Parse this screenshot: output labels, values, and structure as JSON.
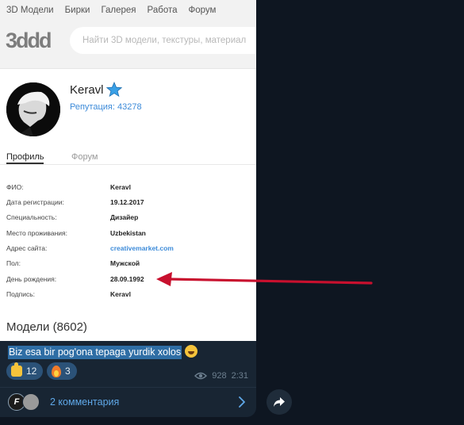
{
  "site": {
    "nav_items": [
      "3D Модели",
      "Бирки",
      "Галерея",
      "Работа",
      "Форум"
    ],
    "logo_text": "3ddd",
    "search_placeholder": "Найти 3D модели, текстуры, материал"
  },
  "profile": {
    "username": "Keravl",
    "reputation": "Репутация: 43278",
    "tabs": [
      "Профиль",
      "Форум"
    ],
    "fields": [
      {
        "label": "ФИО:",
        "value": "Keravl",
        "link": false
      },
      {
        "label": "Дата регистрации:",
        "value": "19.12.2017",
        "link": false
      },
      {
        "label": "Специальность:",
        "value": "Дизайер",
        "link": false
      },
      {
        "label": "Место проживания:",
        "value": "Uzbekistan",
        "link": false
      },
      {
        "label": "Адрес сайта:",
        "value": "creativemarket.com",
        "link": true
      },
      {
        "label": "Пол:",
        "value": "Мужской",
        "link": false
      },
      {
        "label": "День рождения:",
        "value": "28.09.1992",
        "link": false
      },
      {
        "label": "Подпись:",
        "value": "Keravl",
        "link": false
      }
    ],
    "models_heading": "Модели (8602)"
  },
  "message": {
    "caption": "Biz esa bir pog'ona tepaga yurdik xolos",
    "reactions": [
      {
        "icon": "thumbs-up-icon",
        "count": "12"
      },
      {
        "icon": "fire-icon",
        "count": "3"
      }
    ],
    "views": "928",
    "time": "2:31",
    "comments_label": "2 комментария"
  },
  "colors": {
    "chat_background": "#0e1621",
    "bubble": "#182533",
    "link_blue": "#5fa8e8",
    "arrow_red": "#c8102e",
    "selection": "#2f6ea5"
  }
}
